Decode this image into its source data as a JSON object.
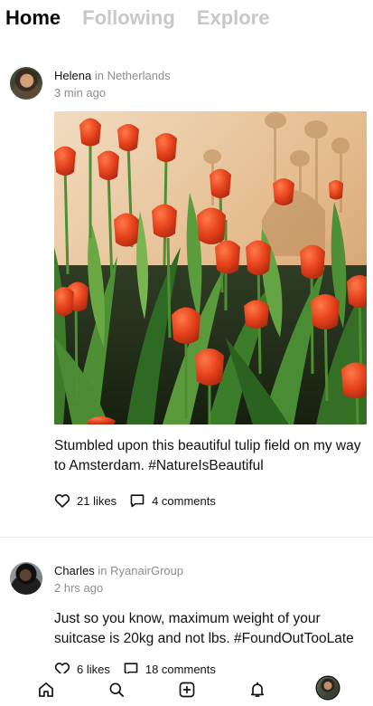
{
  "tabs": {
    "home": "Home",
    "following": "Following",
    "explore": "Explore"
  },
  "posts": [
    {
      "author": "Helena",
      "in_word": "in",
      "location": "Netherlands",
      "time": "3 min ago",
      "text": "Stumbled upon this beautiful tulip field on my way to Amsterdam. #NatureIsBeautiful",
      "likes": "21 likes",
      "comments": "4 comments",
      "has_image": true
    },
    {
      "author": "Charles",
      "in_word": "in",
      "location": "RyanairGroup",
      "time": "2 hrs ago",
      "text": "Just so you know, maximum weight of your suitcase is 20kg and not lbs. #FoundOutTooLate",
      "likes": "6 likes",
      "comments": "18 comments",
      "has_image": false
    }
  ],
  "bottom_nav": {
    "items": [
      "home-icon",
      "search-icon",
      "add-icon",
      "bell-icon",
      "profile-avatar"
    ]
  },
  "colors": {
    "active_tab": "#0a0a0a",
    "inactive_tab": "#c8c8c8",
    "muted_text": "#8e8e8e",
    "divider": "#e6e6e6"
  }
}
